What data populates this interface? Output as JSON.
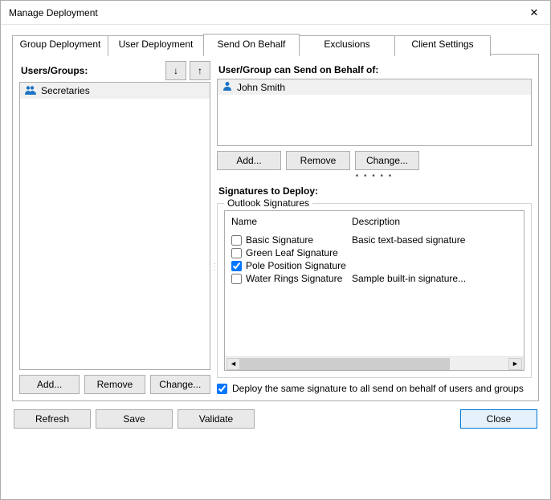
{
  "window": {
    "title": "Manage Deployment"
  },
  "tabs": [
    {
      "label": "Group Deployment"
    },
    {
      "label": "User Deployment"
    },
    {
      "label": "Send On Behalf"
    },
    {
      "label": "Exclusions"
    },
    {
      "label": "Client Settings"
    }
  ],
  "active_tab_index": 2,
  "left_panel": {
    "label": "Users/Groups:",
    "items": [
      {
        "name": "Secretaries",
        "type": "group"
      }
    ],
    "buttons": {
      "add": "Add...",
      "remove": "Remove",
      "change": "Change..."
    }
  },
  "right_panel": {
    "sob_label": "User/Group can Send on Behalf of:",
    "sob_items": [
      {
        "name": "John Smith",
        "type": "user"
      }
    ],
    "sob_buttons": {
      "add": "Add...",
      "remove": "Remove",
      "change": "Change..."
    },
    "sig_label": "Signatures to Deploy:",
    "fieldset_legend": "Outlook Signatures",
    "columns": {
      "name": "Name",
      "desc": "Description"
    },
    "signatures": [
      {
        "checked": false,
        "name": "Basic Signature",
        "desc": "Basic text-based signature"
      },
      {
        "checked": false,
        "name": "Green Leaf Signature",
        "desc": ""
      },
      {
        "checked": true,
        "name": "Pole Position Signature",
        "desc": ""
      },
      {
        "checked": false,
        "name": "Water Rings Signature",
        "desc": "Sample built-in signature..."
      }
    ],
    "deploy_same_checkbox": {
      "checked": true,
      "label": "Deploy the same signature to all send on behalf of users and groups"
    }
  },
  "bottom": {
    "refresh": "Refresh",
    "save": "Save",
    "validate": "Validate",
    "close": "Close"
  }
}
